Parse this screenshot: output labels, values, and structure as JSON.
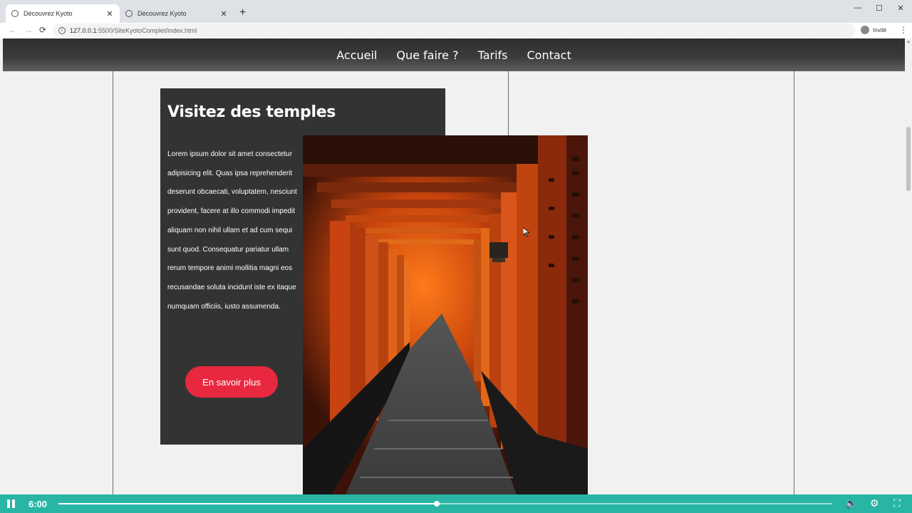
{
  "browser": {
    "tabs": [
      {
        "title": "Découvrez Kyoto",
        "active": true
      },
      {
        "title": "Découvrez Kyoto",
        "active": false
      }
    ],
    "new_tab": "+",
    "window_controls": {
      "minimize": "—",
      "maximize": "☐",
      "close": "✕"
    },
    "tab_close": "✕",
    "url_host": "127.0.0.1",
    "url_path": ":5500/SiteKyotoComplet/index.html",
    "profile_label": "Invité",
    "icons": {
      "back": "←",
      "forward": "→",
      "reload": "⟳",
      "info": "i",
      "menu": "⋮"
    }
  },
  "site": {
    "nav": [
      "Accueil",
      "Que faire ?",
      "Tarifs",
      "Contact"
    ],
    "card": {
      "title": "Visitez des temples",
      "body": "Lorem ipsum dolor sit amet consectetur adipisicing elit. Quas ipsa reprehenderit deserunt obcaecati, voluptatem, nesciunt provident, facere at illo commodi impedit aliquam non nihil ullam et ad cum sequi sunt quod. Consequatur pariatur ullam rerum tempore animi mollitia magni eos recusandae soluta incidunt iste ex itaque numquam officiis, iusto assumenda.",
      "button": "En savoir plus"
    },
    "photo_icon": "torii-gates-photo"
  },
  "player": {
    "time": "6:00",
    "progress": 0.489,
    "accent": "#28b5a4",
    "icons": {
      "volume": "🔈",
      "settings": "⚙",
      "fullscreen": "⛶"
    }
  },
  "colors": {
    "cta": "#e8283f",
    "card_bg": "#333333",
    "nav_bg": "#333333"
  }
}
